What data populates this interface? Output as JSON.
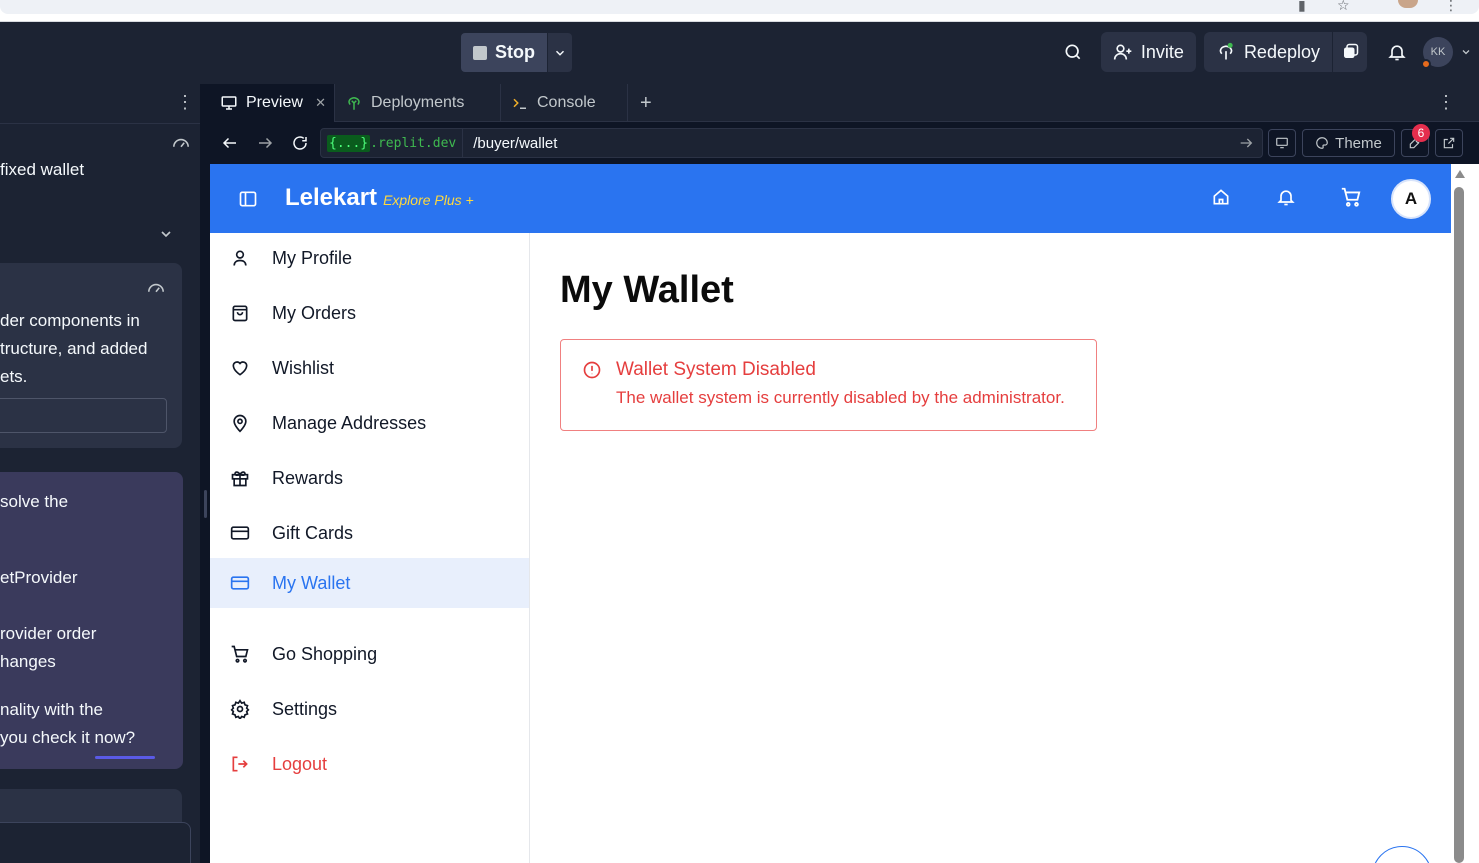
{
  "replit": {
    "stop_label": "Stop",
    "invite_label": "Invite",
    "redeploy_label": "Redeploy",
    "user_initials": "KK"
  },
  "agent_panel": {
    "line1": "fixed wallet",
    "card1_lines": [
      "der components in",
      "tructure, and added",
      "ets."
    ],
    "card2_lines": [
      "solve the",
      "etProvider",
      "rovider order",
      "hanges",
      "nality with the",
      " you check it now?"
    ]
  },
  "tabs": [
    {
      "label": "Preview",
      "icon": "monitor-icon"
    },
    {
      "label": "Deployments",
      "icon": "deployments-icon"
    },
    {
      "label": "Console",
      "icon": "terminal-icon"
    }
  ],
  "urlbar": {
    "host_braces": "{...}",
    "host_domain": ".replit.dev",
    "path": "/buyer/wallet",
    "theme_label": "Theme",
    "devtools_badge": "6"
  },
  "app": {
    "brand": "Lelekart",
    "brand_sub": "Explore Plus +",
    "avatar_initial": "A",
    "nav": [
      {
        "label": "My Profile",
        "icon": "user-icon"
      },
      {
        "label": "My Orders",
        "icon": "shopping-bag-icon"
      },
      {
        "label": "Wishlist",
        "icon": "heart-icon"
      },
      {
        "label": "Manage Addresses",
        "icon": "map-pin-icon"
      },
      {
        "label": "Rewards",
        "icon": "gift-icon"
      },
      {
        "label": "Gift Cards",
        "icon": "credit-card-icon"
      },
      {
        "label": "My Wallet",
        "icon": "wallet-icon"
      },
      {
        "label": "Go Shopping",
        "icon": "cart-icon"
      },
      {
        "label": "Settings",
        "icon": "gear-icon"
      },
      {
        "label": "Logout",
        "icon": "logout-icon"
      }
    ],
    "page_title": "My Wallet",
    "alert": {
      "title": "Wallet System Disabled",
      "description": "The wallet system is currently disabled by the administrator."
    }
  },
  "colors": {
    "header_blue": "#2a74f0",
    "active_nav_bg": "#e8effc",
    "error_red": "#e53e3e",
    "brand_sub_yellow": "#ffd93d",
    "replit_bg": "#1c2333"
  }
}
